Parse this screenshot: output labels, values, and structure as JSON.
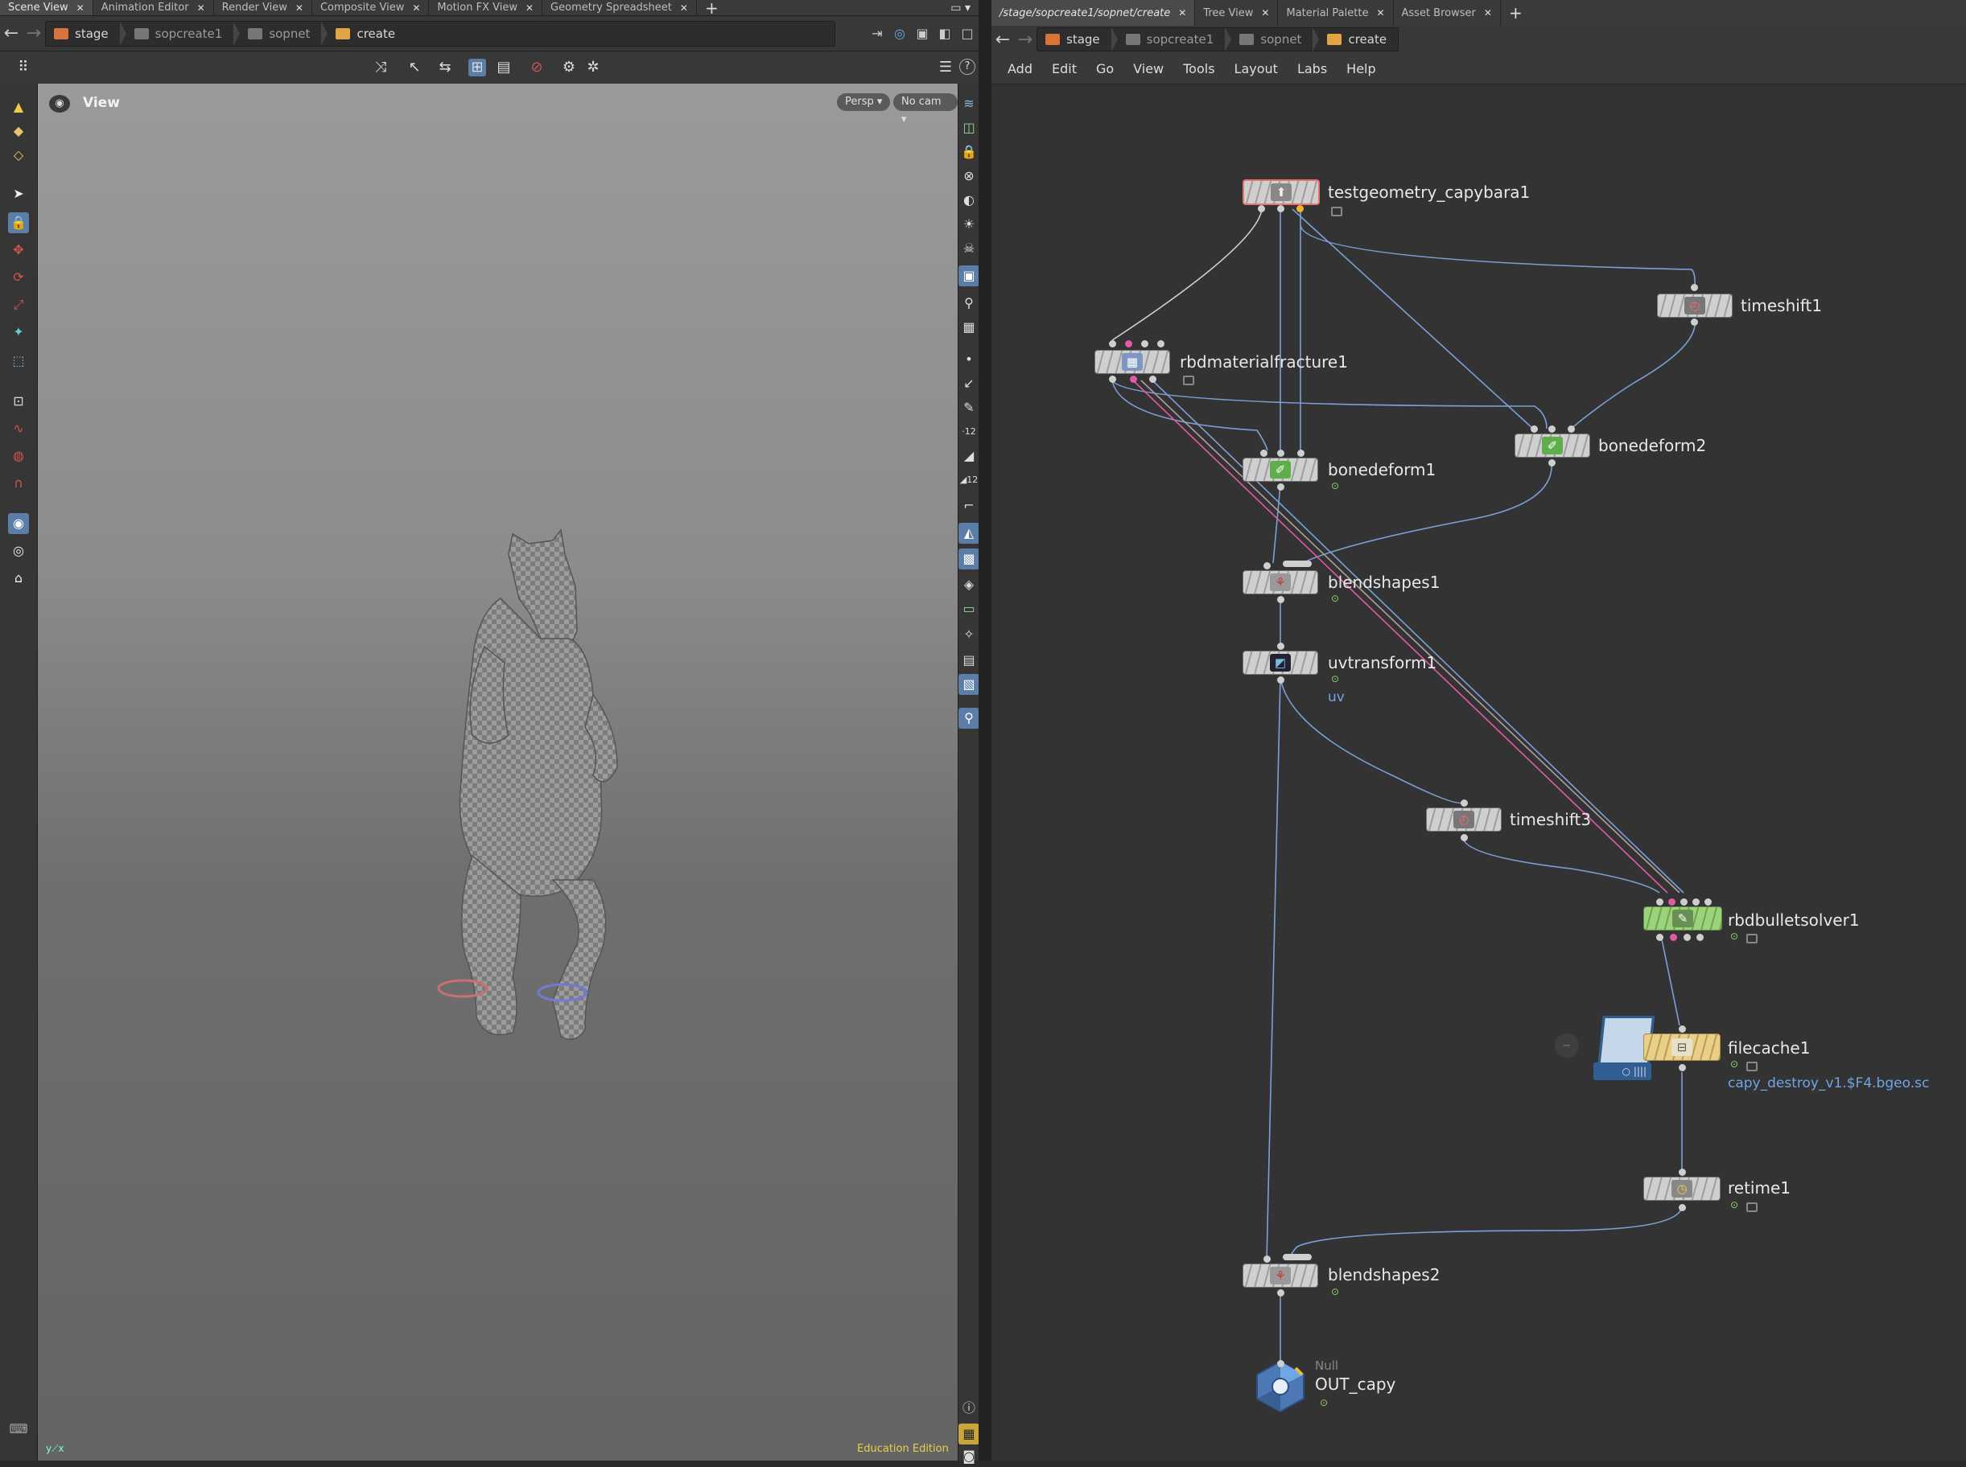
{
  "left_tabs": [
    {
      "label": "Scene View",
      "active": true
    },
    {
      "label": "Animation Editor"
    },
    {
      "label": "Render View"
    },
    {
      "label": "Composite View"
    },
    {
      "label": "Motion FX View"
    },
    {
      "label": "Geometry Spreadsheet"
    }
  ],
  "right_tabs": [
    {
      "label": "/stage/sopcreate1/sopnet/create",
      "active": true
    },
    {
      "label": "Tree View"
    },
    {
      "label": "Material Palette"
    },
    {
      "label": "Asset Browser"
    }
  ],
  "breadcrumbs": [
    "stage",
    "sopcreate1",
    "sopnet",
    "create"
  ],
  "viewport": {
    "title": "View",
    "camera_mode": "Persp",
    "camera": "No cam",
    "edition": "Education Edition"
  },
  "network_menu": [
    "Add",
    "Edit",
    "Go",
    "View",
    "Tools",
    "Layout",
    "Labs",
    "Help"
  ],
  "nodes": {
    "testgeometry": "testgeometry_capybara1",
    "timeshift1": "timeshift1",
    "rbdmaterialfracture": "rbdmaterialfracture1",
    "bonedeform1": "bonedeform1",
    "bonedeform2": "bonedeform2",
    "blendshapes1": "blendshapes1",
    "uvtransform": "uvtransform1",
    "uvtransform_sub": "uv",
    "timeshift3": "timeshift3",
    "rbdbulletsolver": "rbdbulletsolver1",
    "filecache": "filecache1",
    "filecache_sub": "capy_destroy_v1.$F4.bgeo.sc",
    "retime": "retime1",
    "blendshapes2": "blendshapes2",
    "null_type": "Null",
    "null_name": "OUT_capy"
  },
  "colors": {
    "wire": "#7ba0d6",
    "wire_dark": "#cfcfcf",
    "wire_pink": "#e05aa8",
    "selected_outline": "#e9706f",
    "green_node": "#9bd37d",
    "cache_node": "#e9cf88"
  }
}
